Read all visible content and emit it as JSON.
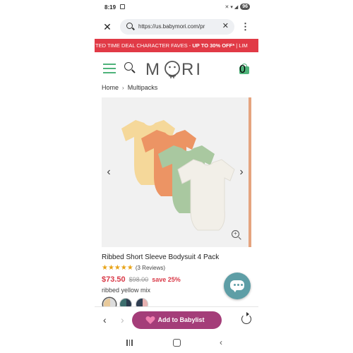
{
  "status_bar": {
    "time": "8:19",
    "signal_text": "✕ ▾ ◢",
    "battery": "96"
  },
  "browser": {
    "url": "https://us.babymori.com/pr",
    "close_icon": "✕",
    "clear_icon": "✕",
    "menu_icon": "⋮"
  },
  "promo": {
    "text_lead": "TED TIME DEAL  CHARACTER FAVES - ",
    "text_bold": "UP TO 30% OFF*",
    "text_tail": " | LIM"
  },
  "header": {
    "logo": "M◡RI",
    "cart_count": "0",
    "brand_color": "#4fb37a"
  },
  "breadcrumb": {
    "home": "Home",
    "separator": "›",
    "current": "Multipacks"
  },
  "gallery": {
    "prev_icon": "‹",
    "next_icon": "›",
    "zoom_icon": "+"
  },
  "product": {
    "title": "Ribbed Short Sleeve Bodysuit 4 Pack",
    "stars": "★★★★★",
    "rating": 5,
    "reviews": "(3 Reviews)",
    "price_now": "$73.50",
    "price_was": "$98.00",
    "save": "save 25%",
    "color_name": "ribbed yellow mix",
    "swatches": [
      {
        "a": "#e8c99a",
        "b": "#dcdcdc"
      },
      {
        "a": "#3d6e6e",
        "b": "#2b3a4d"
      },
      {
        "a": "#2f3e52",
        "b": "#e6b1b1"
      }
    ]
  },
  "toolbar": {
    "back_icon": "‹",
    "forward_icon": "›",
    "babylist_label": "Add to Babylist",
    "babylist_color": "#a43d79"
  }
}
